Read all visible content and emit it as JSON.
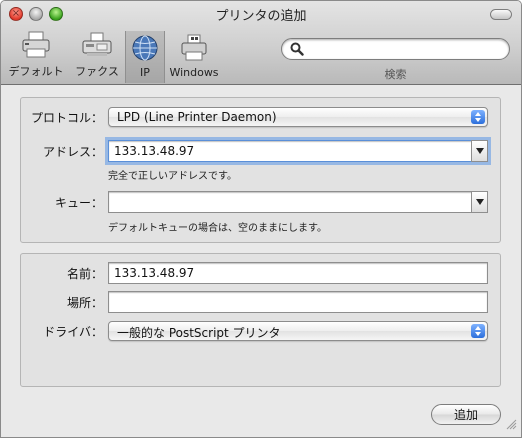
{
  "window": {
    "title": "プリンタの追加"
  },
  "toolbar": {
    "items": [
      {
        "label": "デフォルト",
        "icon": "default-printer-icon"
      },
      {
        "label": "ファクス",
        "icon": "fax-icon"
      },
      {
        "label": "IP",
        "icon": "ip-globe-icon",
        "selected": true
      },
      {
        "label": "Windows",
        "icon": "windows-printer-icon"
      }
    ],
    "search": {
      "value": "",
      "label": "検索"
    }
  },
  "connection": {
    "protocol": {
      "label": "プロトコル：",
      "value": "LPD (Line Printer Daemon)"
    },
    "address": {
      "label": "アドレス：",
      "value": "133.13.48.97",
      "hint": "完全で正しいアドレスです。"
    },
    "queue": {
      "label": "キュー：",
      "value": "",
      "hint": "デフォルトキューの場合は、空のままにします。"
    }
  },
  "printer": {
    "name": {
      "label": "名前：",
      "value": "133.13.48.97"
    },
    "location": {
      "label": "場所：",
      "value": ""
    },
    "driver": {
      "label": "ドライバ：",
      "value": "一般的な PostScript プリンタ"
    }
  },
  "actions": {
    "add": "追加"
  },
  "colors": {
    "accent": "#2c6fdb",
    "focus": "#5a96e6"
  }
}
